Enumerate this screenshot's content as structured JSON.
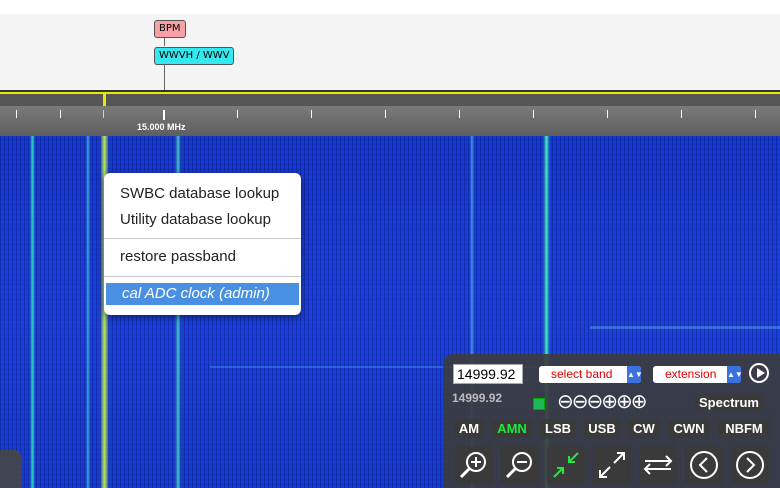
{
  "dx_labels": {
    "bpm": "BPM",
    "wwv": "WWVH / WWV"
  },
  "scale": {
    "center_label": "15.000 MHz"
  },
  "context_menu": {
    "items": [
      "SWBC database lookup",
      "Utility database lookup",
      "restore passband",
      "cal ADC clock (admin)"
    ],
    "highlighted_index": 3
  },
  "control_panel": {
    "frequency_value": "14999.92",
    "frequency_readout": "14999.92",
    "band_select": "select band",
    "extension_select": "extension",
    "zoom_steps": "⊖⊖⊖⊕⊕⊕",
    "spectrum_label": "Spectrum",
    "modes": [
      "AM",
      "AMN",
      "LSB",
      "USB",
      "CW",
      "CWN",
      "NBFM"
    ],
    "active_mode": "AMN"
  },
  "icons": {
    "toolbar": [
      "zoom-in-icon",
      "zoom-out-icon",
      "zoom-to-band-icon",
      "zoom-max-icon",
      "swap-icon",
      "step-left-icon",
      "step-right-icon"
    ]
  },
  "colors": {
    "waterfall_bg": "#1a3ed8",
    "signal": "#2af0a0",
    "marker_yellow": "#e8e800",
    "menu_highlight": "#4a90e2",
    "active_mode": "#1ee83a",
    "band_select_text": "#dd0000"
  }
}
